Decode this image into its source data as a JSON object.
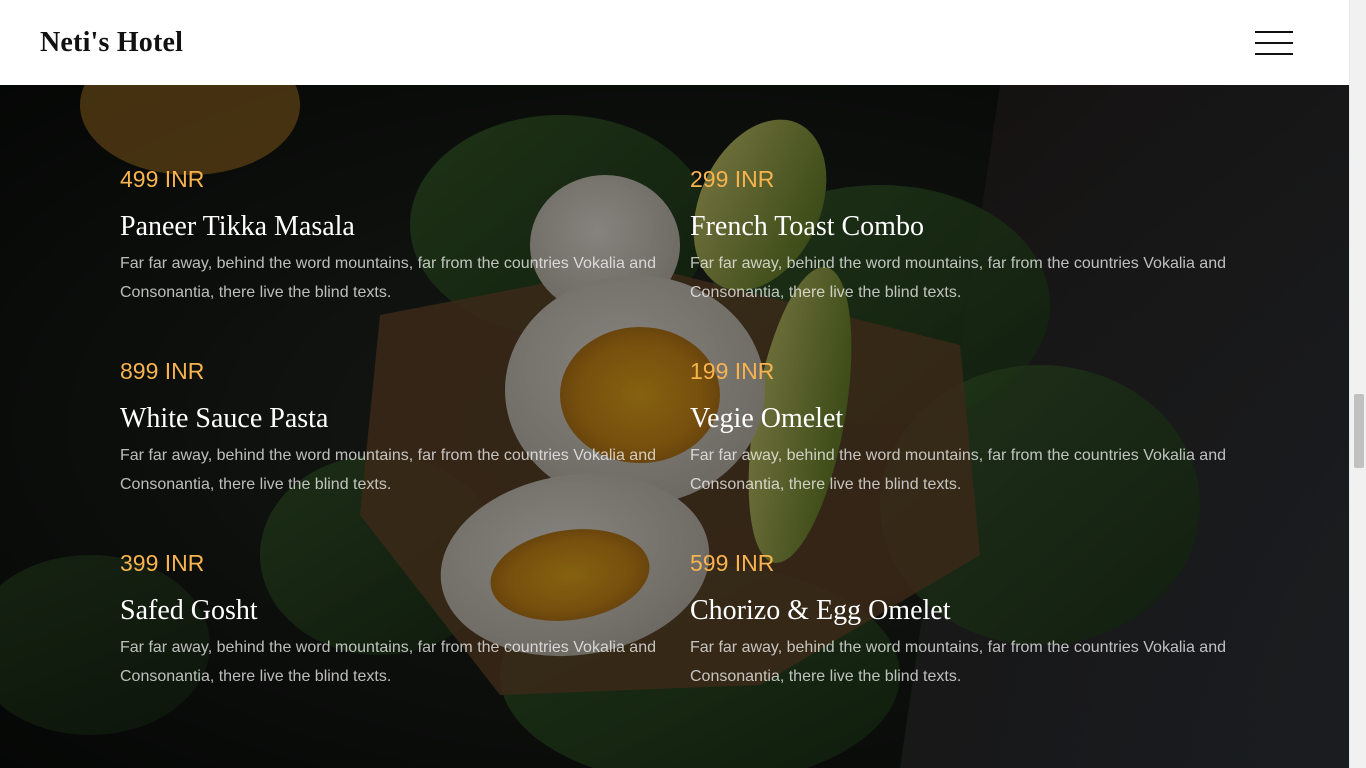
{
  "header": {
    "brand": "Neti's Hotel",
    "menu_icon": "hamburger-menu-icon"
  },
  "menu": {
    "items": [
      {
        "price": "499 INR",
        "name": "Paneer Tikka Masala",
        "description": "Far far away, behind the word mountains, far from the countries Vokalia and Consonantia, there live the blind texts."
      },
      {
        "price": "299 INR",
        "name": "French Toast Combo",
        "description": "Far far away, behind the word mountains, far from the countries Vokalia and Consonantia, there live the blind texts."
      },
      {
        "price": "899 INR",
        "name": "White Sauce Pasta",
        "description": "Far far away, behind the word mountains, far from the countries Vokalia and Consonantia, there live the blind texts."
      },
      {
        "price": "199 INR",
        "name": "Vegie Omelet",
        "description": "Far far away, behind the word mountains, far from the countries Vokalia and Consonantia, there live the blind texts."
      },
      {
        "price": "399 INR",
        "name": "Safed Gosht",
        "description": "Far far away, behind the word mountains, far from the countries Vokalia and Consonantia, there live the blind texts."
      },
      {
        "price": "599 INR",
        "name": "Chorizo & Egg Omelet",
        "description": "Far far away, behind the word mountains, far from the countries Vokalia and Consonantia, there live the blind texts."
      }
    ]
  },
  "colors": {
    "price_accent": "#f7b34d",
    "header_bg": "#ffffff",
    "brand_text": "#111111"
  }
}
